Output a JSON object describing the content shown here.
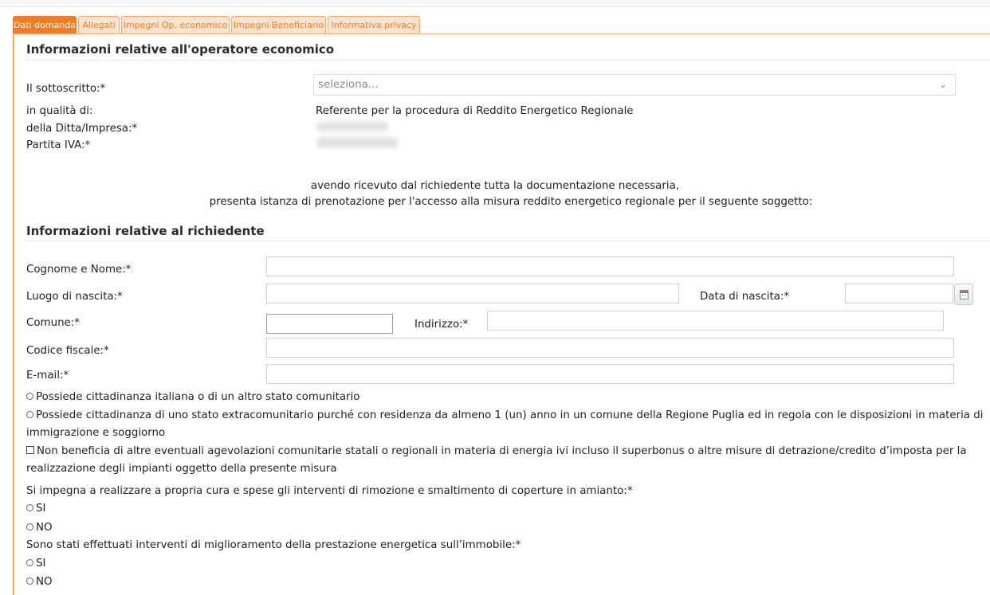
{
  "tabs": [
    "Dati domanda",
    "Allegati",
    "Impegni Op. economico",
    "Impegni Beneficiario",
    "Informativa privacy"
  ],
  "section1": {
    "title": "Informazioni relative all'operatore economico",
    "sottoscritto_label": "Il sottoscritto:*",
    "sottoscritto_select": "seleziona...",
    "qualita_label": "in qualità di:",
    "qualita_value": "Referente per la procedura di Reddito Energetico Regionale",
    "ditta_label": "della Ditta/Impresa:*",
    "piva_label": "Partita IVA:*"
  },
  "declaration": {
    "line1": "avendo ricevuto dal richiedente tutta la documentazione necessaria,",
    "line2": "presenta istanza di prenotazione per l'accesso alla misura reddito energetico regionale per il seguente soggetto:"
  },
  "section2": {
    "title": "Informazioni relative al richiedente",
    "cognome_label": "Cognome e Nome:*",
    "luogo_label": "Luogo di nascita:*",
    "data_label": "Data di nascita:*",
    "comune_label": "Comune:*",
    "indirizzo_label": "Indirizzo:*",
    "cf_label": "Codice fiscale:*",
    "email_label": "E-mail:*"
  },
  "options": {
    "cittadinanza_ue": "Possiede cittadinanza italiana o di un altro stato comunitario",
    "cittadinanza_extra": "Possiede cittadinanza di uno stato extracomunitario purché con residenza da almeno 1 (un) anno in un comune della Regione Puglia ed in regola con le disposizioni in materia di immigrazione e soggiorno",
    "non_beneficia": "Non beneficia di altre eventuali agevolazioni comunitarie statali o regionali in materia di energia ivi incluso il superbonus o altre misure di detrazione/credito d’imposta per la realizzazione degli impianti oggetto della presente misura",
    "amianto_question": "Si impegna a realizzare a propria cura e spese gli interventi di rimozione e smaltimento di coperture in amianto:*",
    "prestazione_question": "Sono stati effettuati interventi di miglioramento della prestazione energetica sull’immobile:*",
    "si": "SI",
    "no": "NO"
  },
  "icons": {
    "select_chevron": "chevron-down-icon",
    "calendar": "calendar-icon"
  },
  "colors": {
    "accent": "#f07d24",
    "tab_inactive_bg": "#fbe3cd"
  }
}
